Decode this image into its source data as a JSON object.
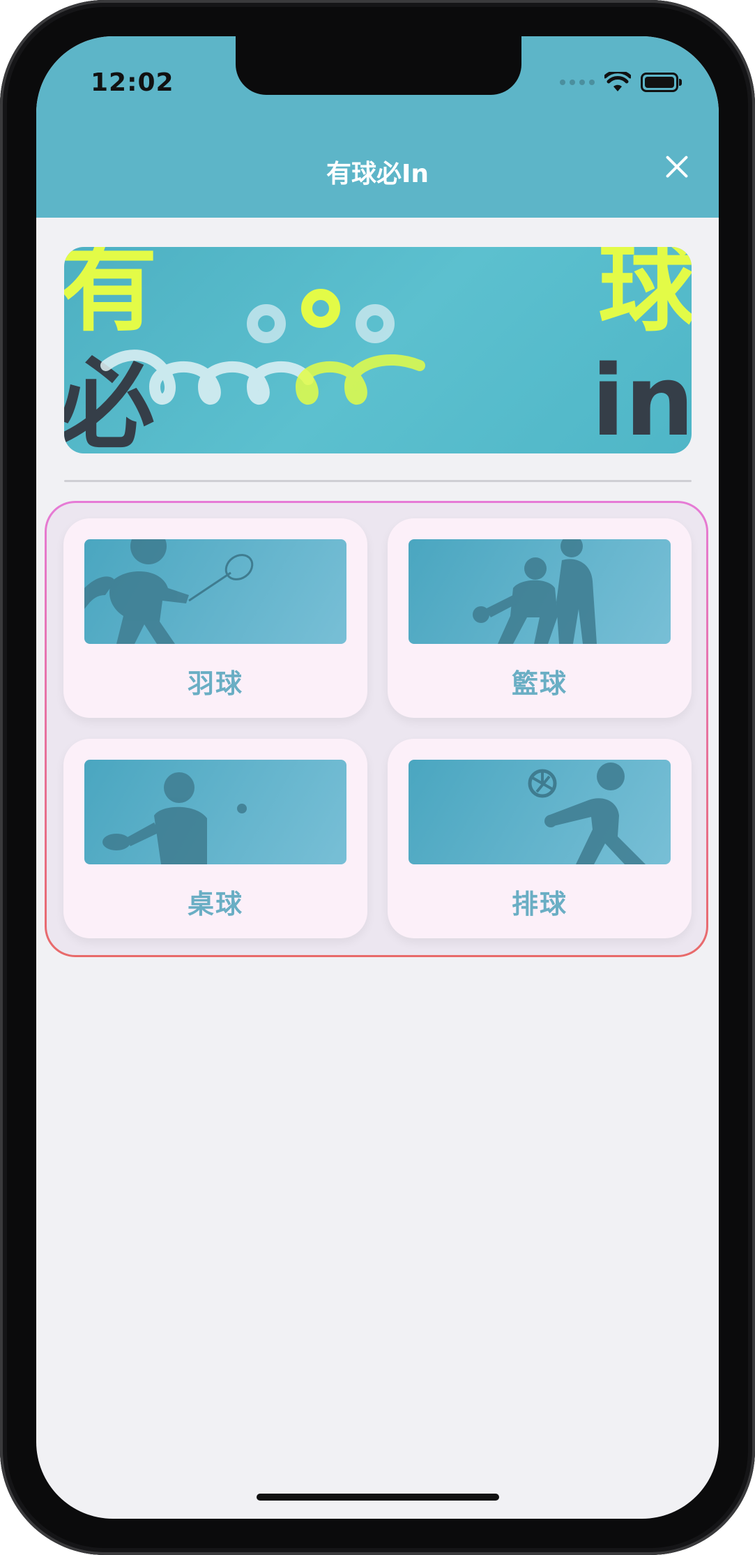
{
  "status_bar": {
    "time": "12:02"
  },
  "header": {
    "title": "有球必In"
  },
  "icons": {
    "close": "close-icon",
    "wifi": "wifi-icon",
    "battery": "battery-icon"
  },
  "banner": {
    "chars": [
      "有",
      "必",
      "球",
      "in"
    ]
  },
  "sports": [
    {
      "label": "羽球",
      "icon": "badminton-player-icon"
    },
    {
      "label": "籃球",
      "icon": "basketball-players-icon"
    },
    {
      "label": "桌球",
      "icon": "table-tennis-player-icon"
    },
    {
      "label": "排球",
      "icon": "volleyball-player-icon"
    }
  ],
  "colors": {
    "header": "#5db5c8",
    "banner_yellow": "#e3fb47",
    "banner_dark": "#353e48",
    "card_bg": "#fcf0f9",
    "label": "#6aaec4",
    "frame_top": "#e67bd6",
    "frame_bottom": "#e86a6a"
  }
}
